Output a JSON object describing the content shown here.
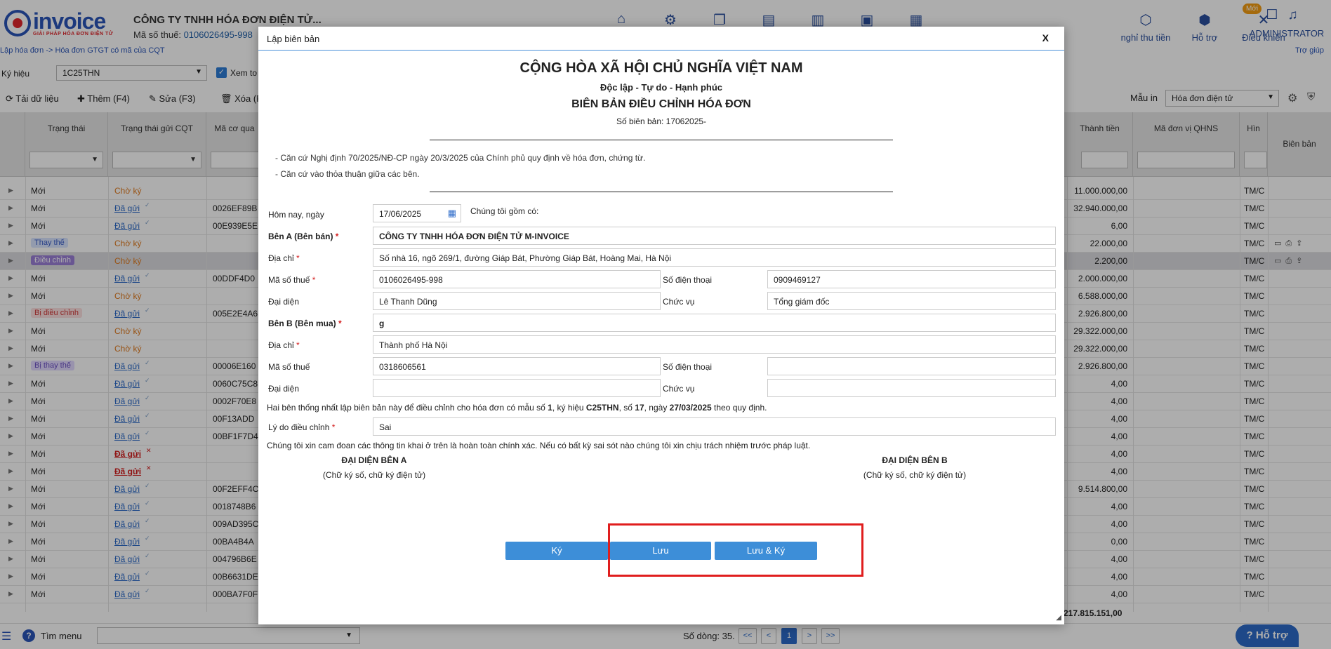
{
  "header": {
    "logo_word": "invoice",
    "logo_tagline": "GIẢI PHÁP HÓA ĐƠN ĐIỆN TỬ",
    "company": "CÔNG TY TNHH HÓA ĐƠN ĐIỆN TỬ...",
    "tax_label": "Mã số thuế:",
    "tax_value": "0106026495-998",
    "breadcrumb": "Lập hóa đơn -> Hóa đơn GTGT có mã của CQT",
    "menu": [
      {
        "label": "nghỉ thu tiền",
        "icon": "box-icon"
      },
      {
        "label": "Hỗ trợ",
        "icon": "cube-icon"
      },
      {
        "label": "Điều khiển",
        "icon": "tools-icon"
      }
    ],
    "admin": "ADMINISTRATOR",
    "new_badge": "Mới",
    "help": "Trợ giúp"
  },
  "filter": {
    "label": "Ký hiệu",
    "value": "1C25THN",
    "checkbox_label": "Xem to"
  },
  "toolbar": {
    "reload": "Tải dữ liệu",
    "add": "Thêm (F4)",
    "edit": "Sửa (F3)",
    "delete": "Xóa (F",
    "print_label": "Mẫu in",
    "print_value": "Hóa đơn điện tử"
  },
  "grid": {
    "columns": {
      "status": "Trạng thái",
      "cqt": "Trạng thái gửi CQT",
      "code": "Mã cơ qua",
      "amount": "Thành tiền",
      "qhns": "Mã đơn vị QHNS",
      "method": "Hìn",
      "record": "Biên bản"
    },
    "rows": [
      {
        "status": "Mới",
        "stype": "",
        "cqt": "Chờ ký",
        "ctype": "wait",
        "code": "",
        "amount": "11.000.000,00",
        "method": "TM/C"
      },
      {
        "status": "Mới",
        "stype": "",
        "cqt": "Đã gửi",
        "ctype": "sent",
        "code": "0026EF89B",
        "amount": "32.940.000,00",
        "method": "TM/C"
      },
      {
        "status": "Mới",
        "stype": "",
        "cqt": "Đã gửi",
        "ctype": "sent",
        "code": "00E939E5E",
        "amount": "6,00",
        "method": "TM/C"
      },
      {
        "status": "Thay thế",
        "stype": "thay",
        "cqt": "Chờ ký",
        "ctype": "wait",
        "code": "",
        "amount": "22.000,00",
        "method": "TM/C"
      },
      {
        "status": "Điều chỉnh",
        "stype": "dc",
        "cqt": "Chờ ký",
        "ctype": "wait",
        "code": "",
        "amount": "2.200,00",
        "method": "TM/C"
      },
      {
        "status": "Mới",
        "stype": "",
        "cqt": "Đã gửi",
        "ctype": "sent",
        "code": "00DDF4D0",
        "amount": "2.000.000,00",
        "method": "TM/C"
      },
      {
        "status": "Mới",
        "stype": "",
        "cqt": "Chờ ký",
        "ctype": "wait",
        "code": "",
        "amount": "6.588.000,00",
        "method": "TM/C"
      },
      {
        "status": "Bị điều chỉnh",
        "stype": "bidc",
        "cqt": "Đã gửi",
        "ctype": "sent",
        "code": "005E2E4A6",
        "amount": "2.926.800,00",
        "method": "TM/C"
      },
      {
        "status": "Mới",
        "stype": "",
        "cqt": "Chờ ký",
        "ctype": "wait",
        "code": "",
        "amount": "29.322.000,00",
        "method": "TM/C"
      },
      {
        "status": "Mới",
        "stype": "",
        "cqt": "Chờ ký",
        "ctype": "wait",
        "code": "",
        "amount": "29.322.000,00",
        "method": "TM/C"
      },
      {
        "status": "Bị thay thế",
        "stype": "bithay",
        "cqt": "Đã gửi",
        "ctype": "sent",
        "code": "00006E160",
        "amount": "2.926.800,00",
        "method": "TM/C"
      },
      {
        "status": "Mới",
        "stype": "",
        "cqt": "Đã gửi",
        "ctype": "sent",
        "code": "0060C75C8",
        "amount": "4,00",
        "method": "TM/C"
      },
      {
        "status": "Mới",
        "stype": "",
        "cqt": "Đã gửi",
        "ctype": "sent",
        "code": "0002F70E8",
        "amount": "4,00",
        "method": "TM/C"
      },
      {
        "status": "Mới",
        "stype": "",
        "cqt": "Đã gửi",
        "ctype": "sent",
        "code": "00F13ADD",
        "amount": "4,00",
        "method": "TM/C"
      },
      {
        "status": "Mới",
        "stype": "",
        "cqt": "Đã gửi",
        "ctype": "sent",
        "code": "00BF1F7D4",
        "amount": "4,00",
        "method": "TM/C"
      },
      {
        "status": "Mới",
        "stype": "",
        "cqt": "Đã gửi",
        "ctype": "err",
        "code": "",
        "amount": "4,00",
        "method": "TM/C"
      },
      {
        "status": "Mới",
        "stype": "",
        "cqt": "Đã gửi",
        "ctype": "err",
        "code": "",
        "amount": "4,00",
        "method": "TM/C"
      },
      {
        "status": "Mới",
        "stype": "",
        "cqt": "Đã gửi",
        "ctype": "sent",
        "code": "00F2EFF4C",
        "amount": "9.514.800,00",
        "method": "TM/C"
      },
      {
        "status": "Mới",
        "stype": "",
        "cqt": "Đã gửi",
        "ctype": "sent",
        "code": "0018748B6",
        "amount": "4,00",
        "method": "TM/C"
      },
      {
        "status": "Mới",
        "stype": "",
        "cqt": "Đã gửi",
        "ctype": "sent",
        "code": "009AD395C",
        "amount": "4,00",
        "method": "TM/C"
      },
      {
        "status": "Mới",
        "stype": "",
        "cqt": "Đã gửi",
        "ctype": "sent",
        "code": "00BA4B4A",
        "amount": "0,00",
        "method": "TM/C"
      },
      {
        "status": "Mới",
        "stype": "",
        "cqt": "Đã gửi",
        "ctype": "sent",
        "code": "004796B6E",
        "amount": "4,00",
        "method": "TM/C"
      },
      {
        "status": "Mới",
        "stype": "",
        "cqt": "Đã gửi",
        "ctype": "sent",
        "code": "00B6631DE",
        "amount": "4,00",
        "method": "TM/C"
      },
      {
        "status": "Mới",
        "stype": "",
        "cqt": "Đã gửi",
        "ctype": "sent",
        "code": "000BA7F0F",
        "amount": "4,00",
        "method": "TM/C"
      }
    ],
    "total": "217.815.151,00"
  },
  "bottom": {
    "find_menu": "Tìm menu",
    "row_count": "Số dòng: 35.",
    "pages": [
      "<<",
      "<",
      "1",
      ">",
      ">>"
    ],
    "help_button": "Hỗ trợ"
  },
  "modal": {
    "title": "Lập biên bản",
    "close": "X",
    "nation": "CỘNG HÒA XÃ HỘI CHỦ NGHĨA VIỆT NAM",
    "motto": "Độc lập - Tự do - Hạnh phúc",
    "doc_title": "BIÊN BẢN ĐIỀU CHỈNH HÓA ĐƠN",
    "doc_no": "Số biên bản: 17062025-",
    "basis_1": "- Căn cứ Nghị định 70/2025/NĐ-CP ngày 20/3/2025 của Chính phủ quy định về hóa đơn, chứng từ.",
    "basis_2": "- Căn cứ vào thỏa thuận giữa các bên.",
    "date_label": "Hôm nay, ngày",
    "date_value": "17/06/2025",
    "we_include": "Chúng tôi gồm có:",
    "party_a_label": "Bên A (Bên bán)",
    "party_a_value": "CÔNG TY TNHH HÓA ĐƠN ĐIỆN TỬ M-INVOICE",
    "addr_label": "Địa chỉ",
    "a_addr": "Số nhà 16, ngõ 269/1, đường Giáp Bát, Phường Giáp Bát, Hoàng Mai, Hà Nội",
    "tax_label": "Mã số thuế",
    "a_tax": "0106026495-998",
    "phone_label": "Số điện thoại",
    "a_phone": "0909469127",
    "rep_label": "Đại diện",
    "a_rep": "Lê Thanh Dũng",
    "pos_label": "Chức vụ",
    "a_pos": "Tổng giám đốc",
    "party_b_label": "Bên B (Bên mua)",
    "party_b_value": "g",
    "b_addr": "Thành phố Hà Nội",
    "b_tax": "0318606561",
    "b_phone": "",
    "b_rep": "",
    "b_pos": "",
    "agree_1": "Hai bên thống nhất lập biên bản này để điều chỉnh cho hóa đơn có mẫu số ",
    "agree_form": "1",
    "agree_2": ", ký hiệu ",
    "agree_symbol": "C25THN",
    "agree_3": ", số ",
    "agree_no": "17",
    "agree_4": ", ngày ",
    "agree_date": "27/03/2025",
    "agree_5": " theo quy định.",
    "reason_label": "Lý do điều chỉnh",
    "reason_value": "Sai",
    "commit": "Chúng tôi xin cam đoan các thông tin khai ở trên là hoàn toàn chính xác. Nếu có bất kỳ sai sót nào chúng tôi xin chịu trách nhiệm trước pháp luật.",
    "sig_a": "ĐẠI DIỆN BÊN A",
    "sig_b": "ĐẠI DIỆN BÊN B",
    "sig_note": "(Chữ ký số, chữ ký điện tử)",
    "btn_sign": "Ký",
    "btn_save": "Lưu",
    "btn_save_sign": "Lưu & Ký"
  }
}
